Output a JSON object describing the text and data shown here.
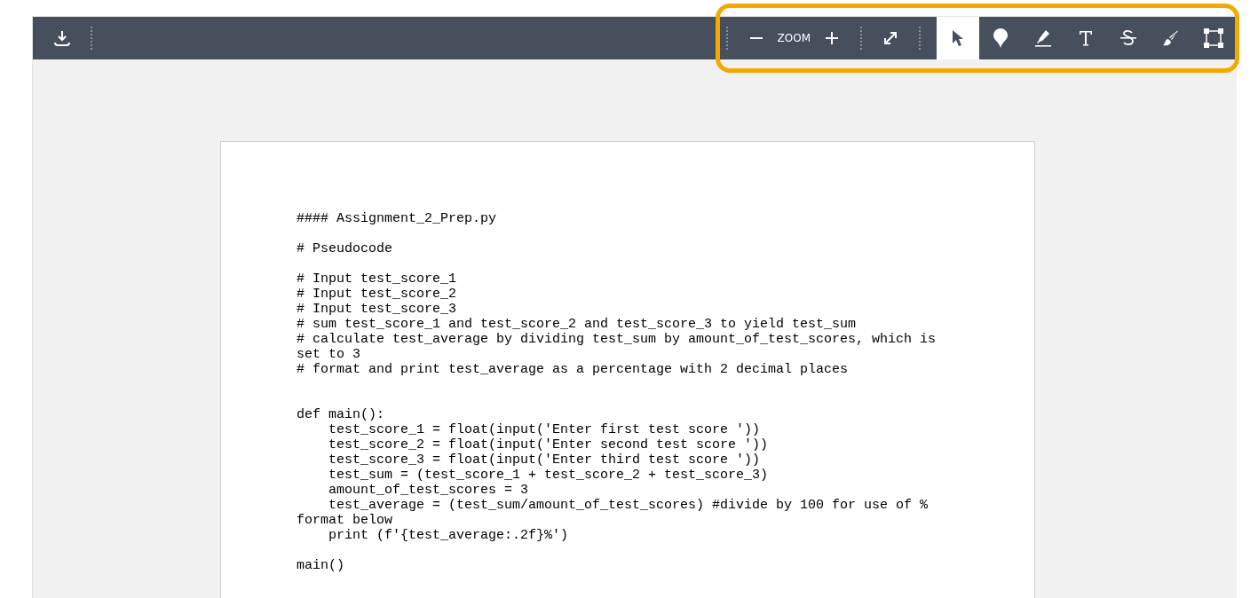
{
  "toolbar": {
    "zoom_label": "ZOOM",
    "tools": [
      {
        "kind": "select",
        "selected": true
      },
      {
        "kind": "pin",
        "selected": false
      },
      {
        "kind": "highlight",
        "selected": false
      },
      {
        "kind": "text",
        "selected": false
      },
      {
        "kind": "strike",
        "selected": false
      },
      {
        "kind": "draw",
        "selected": false
      },
      {
        "kind": "area",
        "selected": false
      }
    ]
  },
  "highlight_frame": {
    "color": "#f5a800"
  },
  "document": {
    "blocks": [
      {
        "wide_gap_after": false,
        "lines": [
          "#### Assignment_2_Prep.py"
        ]
      },
      {
        "wide_gap_after": false,
        "lines": [
          "# Pseudocode"
        ]
      },
      {
        "wide_gap_after": true,
        "lines": [
          "# Input test_score_1",
          "# Input test_score_2",
          "# Input test_score_3",
          "# sum test_score_1 and test_score_2 and test_score_3 to yield test_sum",
          "# calculate test_average by dividing test_sum by amount_of_test_scores, which is",
          "set to 3",
          "# format and print test_average as a percentage with 2 decimal places"
        ]
      },
      {
        "wide_gap_after": false,
        "lines": [
          "def main():",
          "    test_score_1 = float(input('Enter first test score '))",
          "    test_score_2 = float(input('Enter second test score '))",
          "    test_score_3 = float(input('Enter third test score '))",
          "    test_sum = (test_score_1 + test_score_2 + test_score_3)",
          "    amount_of_test_scores = 3",
          "    test_average = (test_sum/amount_of_test_scores) #divide by 100 for use of %",
          "format below",
          "    print (f'{test_average:.2f}%')"
        ]
      },
      {
        "wide_gap_after": false,
        "lines": [
          "main()"
        ]
      }
    ]
  }
}
